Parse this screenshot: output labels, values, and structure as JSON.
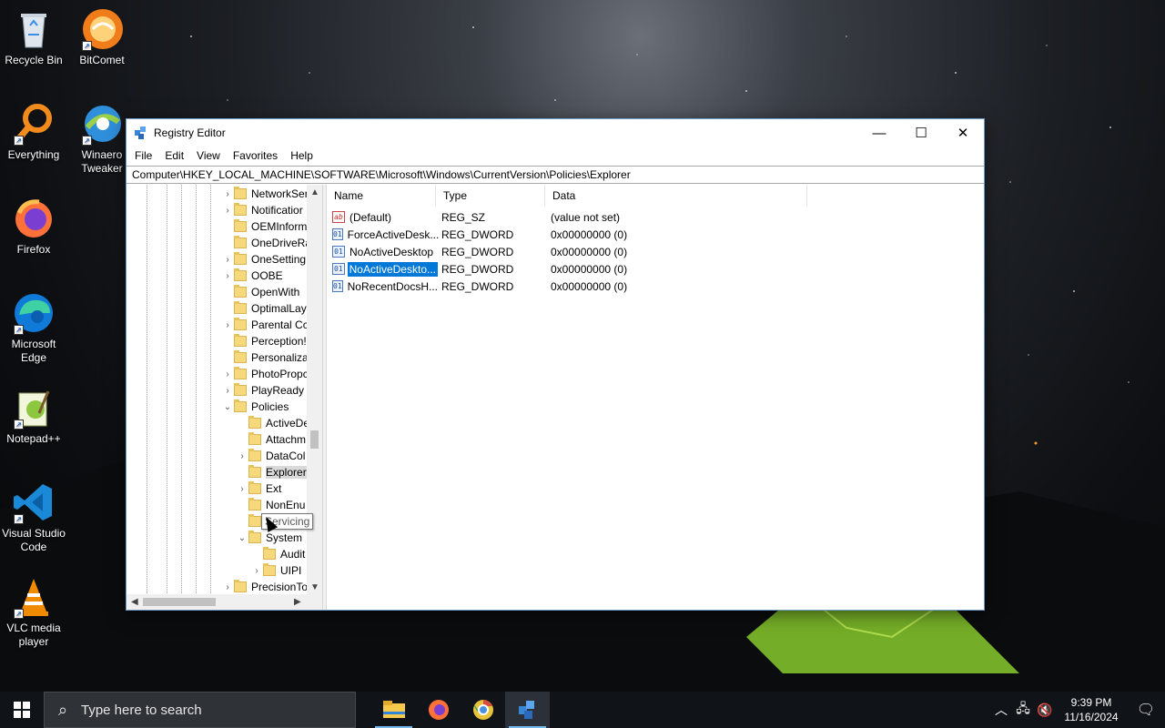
{
  "desktop": {
    "icons": [
      {
        "label": "Recycle Bin",
        "icon": "recycle-bin-icon"
      },
      {
        "label": "BitComet",
        "icon": "bitcomet-icon"
      },
      {
        "label": "Everything",
        "icon": "everything-icon"
      },
      {
        "label": "Winaero Tweaker",
        "icon": "winaero-tweaker-icon"
      },
      {
        "label": "Firefox",
        "icon": "firefox-icon"
      },
      {
        "label": "Microsoft Edge",
        "icon": "edge-icon"
      },
      {
        "label": "Notepad++",
        "icon": "notepad-plus-plus-icon"
      },
      {
        "label": "Visual Studio Code",
        "icon": "vscode-icon"
      },
      {
        "label": "VLC media player",
        "icon": "vlc-icon"
      }
    ]
  },
  "window": {
    "title": "Registry Editor",
    "controls": {
      "minimize": "—",
      "maximize": "☐",
      "close": "✕"
    },
    "menu": [
      "File",
      "Edit",
      "View",
      "Favorites",
      "Help"
    ],
    "address": "Computer\\HKEY_LOCAL_MACHINE\\SOFTWARE\\Microsoft\\Windows\\CurrentVersion\\Policies\\Explorer",
    "tree": [
      {
        "label": "NetworkSer",
        "expandable": true,
        "level": 0
      },
      {
        "label": "Notificatior",
        "expandable": true,
        "level": 0
      },
      {
        "label": "OEMInform",
        "expandable": false,
        "level": 0
      },
      {
        "label": "OneDriveRa",
        "expandable": false,
        "level": 0
      },
      {
        "label": "OneSetting",
        "expandable": true,
        "level": 0
      },
      {
        "label": "OOBE",
        "expandable": true,
        "level": 0
      },
      {
        "label": "OpenWith",
        "expandable": false,
        "level": 0
      },
      {
        "label": "OptimalLay",
        "expandable": false,
        "level": 0
      },
      {
        "label": "Parental Cc",
        "expandable": true,
        "level": 0
      },
      {
        "label": "Perception!",
        "expandable": false,
        "level": 0
      },
      {
        "label": "Personaliza",
        "expandable": false,
        "level": 0
      },
      {
        "label": "PhotoPropc",
        "expandable": true,
        "level": 0
      },
      {
        "label": "PlayReady",
        "expandable": true,
        "level": 0
      },
      {
        "label": "Policies",
        "expandable": true,
        "expanded": true,
        "level": 0
      },
      {
        "label": "ActiveDe",
        "expandable": false,
        "level": 1
      },
      {
        "label": "Attachm",
        "expandable": false,
        "level": 1
      },
      {
        "label": "DataCol",
        "expandable": true,
        "level": 1
      },
      {
        "label": "Explorer",
        "expandable": false,
        "level": 1,
        "selected": true
      },
      {
        "label": "Ext",
        "expandable": true,
        "level": 1
      },
      {
        "label": "NonEnu",
        "expandable": false,
        "level": 1
      },
      {
        "label": "",
        "expandable": false,
        "level": 1
      },
      {
        "label": "System",
        "expandable": true,
        "expanded": true,
        "level": 1
      },
      {
        "label": "Audit",
        "expandable": false,
        "level": 2
      },
      {
        "label": "UIPI",
        "expandable": true,
        "level": 2
      },
      {
        "label": "PrecisionTo",
        "expandable": true,
        "level": 0
      }
    ],
    "tooltip": "Servicing",
    "columns": {
      "name": "Name",
      "type": "Type",
      "data": "Data"
    },
    "values": [
      {
        "name": "(Default)",
        "type": "REG_SZ",
        "data": "(value not set)",
        "icon": "string-value-icon"
      },
      {
        "name": "ForceActiveDesk...",
        "type": "REG_DWORD",
        "data": "0x00000000 (0)",
        "icon": "dword-value-icon"
      },
      {
        "name": "NoActiveDesktop",
        "type": "REG_DWORD",
        "data": "0x00000000 (0)",
        "icon": "dword-value-icon"
      },
      {
        "name": "NoActiveDeskto...",
        "type": "REG_DWORD",
        "data": "0x00000000 (0)",
        "icon": "dword-value-icon",
        "selected": true
      },
      {
        "name": "NoRecentDocsH...",
        "type": "REG_DWORD",
        "data": "0x00000000 (0)",
        "icon": "dword-value-icon"
      }
    ]
  },
  "taskbar": {
    "search_placeholder": "Type here to search",
    "apps": [
      "file-explorer-icon",
      "firefox-icon",
      "chrome-icon",
      "registry-editor-icon"
    ],
    "clock": {
      "time": "9:39 PM",
      "date": "11/16/2024"
    }
  }
}
